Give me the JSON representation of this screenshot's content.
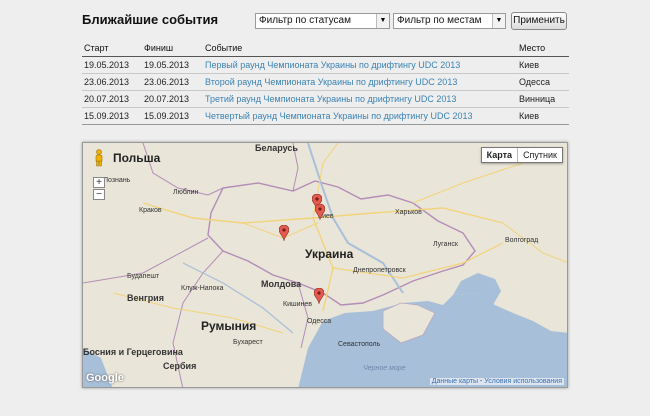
{
  "header": {
    "title": "Ближайшие события"
  },
  "filters": {
    "status_select": "Фильтр по статусам",
    "place_select": "Фильтр по местам",
    "apply_label": "Применить"
  },
  "table": {
    "columns": {
      "start": "Старт",
      "finish": "Финиш",
      "event": "Событие",
      "place": "Место"
    },
    "rows": [
      {
        "start": "19.05.2013",
        "finish": "19.05.2013",
        "event": "Первый раунд Чемпионата Украины по дрифтингу UDC 2013",
        "place": "Киев"
      },
      {
        "start": "23.06.2013",
        "finish": "23.06.2013",
        "event": "Второй раунд Чемпионата Украины по дрифтингу UDC 2013",
        "place": "Одесса"
      },
      {
        "start": "20.07.2013",
        "finish": "20.07.2013",
        "event": "Третий раунд Чемпионата Украины по дрифтингу UDC 2013",
        "place": "Винница"
      },
      {
        "start": "15.09.2013",
        "finish": "15.09.2013",
        "event": "Четвертый раунд Чемпионата Украины по дрифтингу UDC 2013",
        "place": "Киев"
      }
    ]
  },
  "map": {
    "type_map": "Карта",
    "type_satellite": "Спутник",
    "zoom_in": "+",
    "zoom_out": "−",
    "logo": "Google",
    "attrib_data": "Данные карты",
    "attrib_sep": " - ",
    "attrib_terms": "Условия использования",
    "labels": {
      "poland": "Польша",
      "belarus": "Беларусь",
      "ukraine": "Украина",
      "romania": "Румыния",
      "hungary": "Венгрия",
      "moldova": "Молдова",
      "bosnia": "Босния и Герцеговина",
      "serbia": "Сербия",
      "kharkov": "Харьков",
      "luhansk": "Луганск",
      "volgograd": "Волгоград",
      "dnepropetrovsk": "Днепропетровск",
      "krakow": "Краков",
      "lublin": "Люблин",
      "poznan": "Познань",
      "budapest": "Будапешт",
      "kishinev": "Кишинев",
      "odessa": "Одесса",
      "bucharest": "Бухарест",
      "kluj": "Клуж-Напока",
      "sevastopol": "Севастополь",
      "black_sea": "Черное море",
      "kiev": "Киев"
    }
  }
}
